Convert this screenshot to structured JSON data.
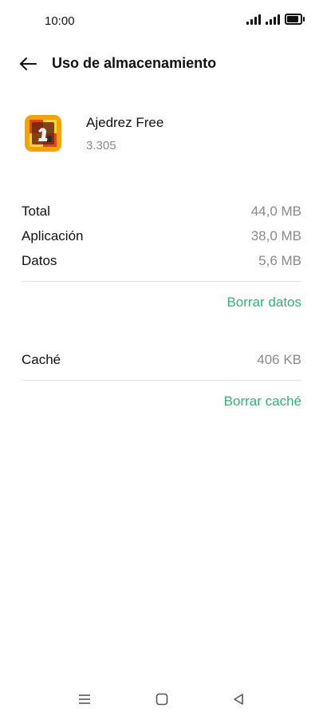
{
  "status_bar": {
    "time": "10:00",
    "battery_level": 1.0,
    "icons": [
      "signal-1-icon",
      "signal-2-icon",
      "battery-icon"
    ]
  },
  "header": {
    "back_icon": "arrow-left-icon",
    "title": "Uso de almacenamiento"
  },
  "app": {
    "icon": "chess-app-icon",
    "name": "Ajedrez Free",
    "version": "3.305",
    "icon_colors": [
      "#f5a300",
      "#e4441c",
      "#ffd23f",
      "#6a2a14"
    ]
  },
  "storage": {
    "rows": [
      {
        "label": "Total",
        "value": "44,0 MB"
      },
      {
        "label": "Aplicación",
        "value": "38,0 MB"
      },
      {
        "label": "Datos",
        "value": "5,6 MB"
      }
    ],
    "clear_data_label": "Borrar datos"
  },
  "cache": {
    "label": "Caché",
    "value": "406 KB",
    "clear_cache_label": "Borrar caché"
  },
  "colors": {
    "accent": "#2bb673",
    "secondary_text": "#8a8a8a",
    "divider": "#e6e6e6"
  },
  "navbar": {
    "icons": [
      "menu-icon",
      "home-square-icon",
      "back-triangle-icon"
    ]
  }
}
